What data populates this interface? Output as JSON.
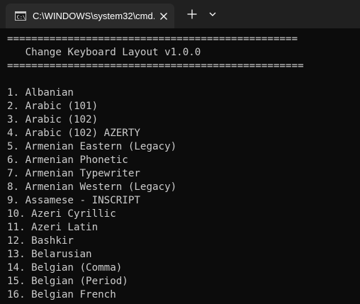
{
  "tab": {
    "title": "C:\\WINDOWS\\system32\\cmd.",
    "icon": "cmd-prompt-icon",
    "close_icon": "close-icon"
  },
  "toolbar": {
    "new_tab_icon": "plus-icon",
    "dropdown_icon": "chevron-down-icon"
  },
  "console": {
    "border_top": "================================================",
    "title": "   Change Keyboard Layout v1.0.0",
    "border_bottom": "=================================================",
    "items": [
      "1. Albanian",
      "2. Arabic (101)",
      "3. Arabic (102)",
      "4. Arabic (102) AZERTY",
      "5. Armenian Eastern (Legacy)",
      "6. Armenian Phonetic",
      "7. Armenian Typewriter",
      "8. Armenian Western (Legacy)",
      "9. Assamese - INSCRIPT",
      "10. Azeri Cyrillic",
      "11. Azeri Latin",
      "12. Bashkir",
      "13. Belarusian",
      "14. Belgian (Comma)",
      "15. Belgian (Period)",
      "16. Belgian French"
    ]
  },
  "colors": {
    "console_bg": "#0c0c0c",
    "console_text": "#cccccc",
    "tabbar_bg": "#202020",
    "tab_bg": "#2b2b2b"
  }
}
